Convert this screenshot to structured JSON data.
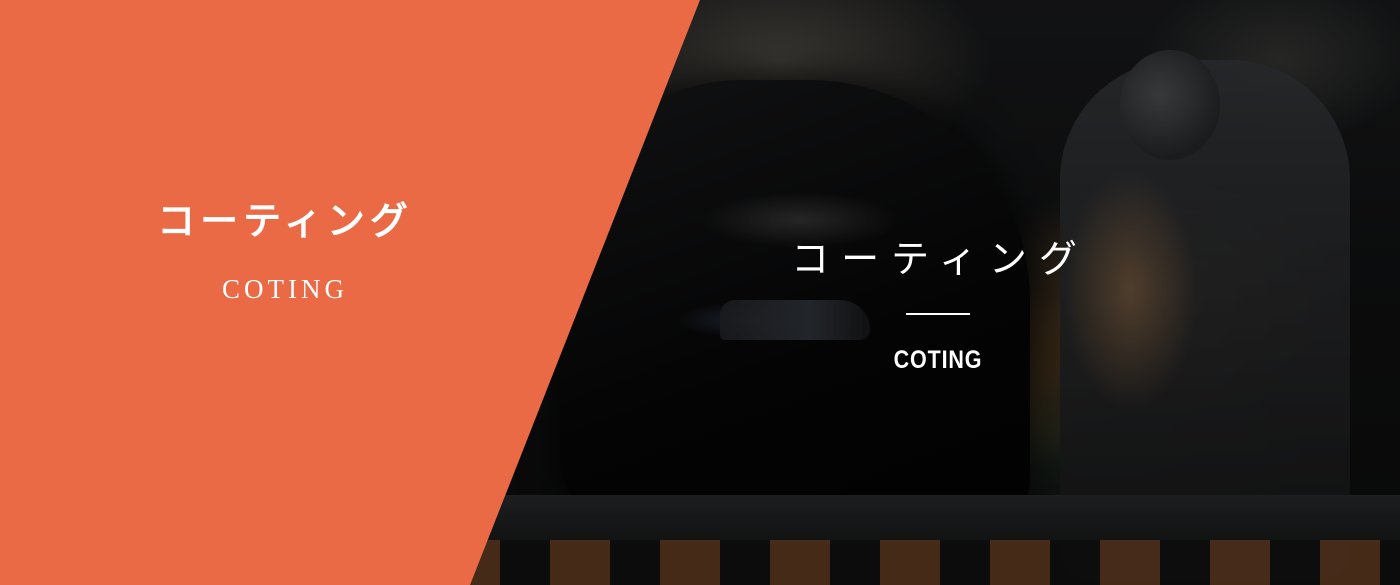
{
  "colors": {
    "accent_panel": "#ea6a46",
    "text": "#ffffff",
    "photo_overlay": "#0b0b0c"
  },
  "hero": {
    "panel": {
      "title": "コーティング",
      "subtitle": "COTING"
    },
    "photo": {
      "title": "コーティング",
      "subtitle": "COTING",
      "image_subject": "worker-coating-black-car-photo"
    }
  }
}
